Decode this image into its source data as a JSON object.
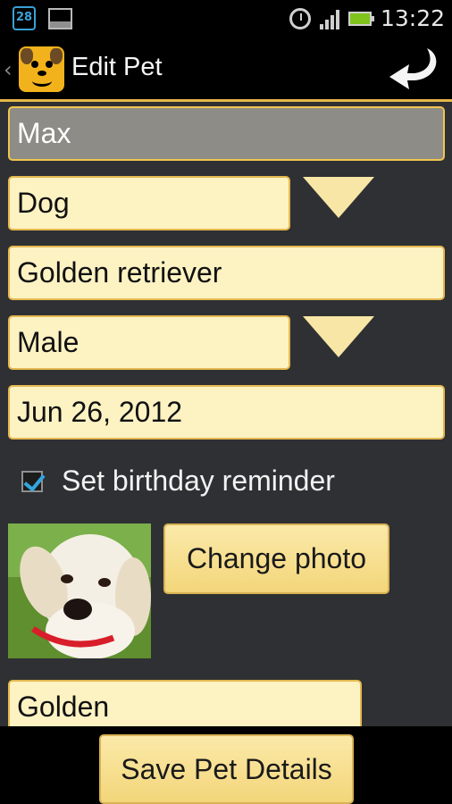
{
  "status_bar": {
    "calendar_day": "28",
    "time": "13:22"
  },
  "action_bar": {
    "title": "Edit Pet"
  },
  "form": {
    "name": "Max",
    "species": "Dog",
    "breed": "Golden retriever",
    "sex": "Male",
    "birthday": "Jun 26, 2012",
    "birthday_reminder": {
      "label": "Set birthday reminder",
      "checked": true
    },
    "change_photo_label": "Change photo",
    "color": "Golden"
  },
  "footer": {
    "save_label": "Save Pet Details"
  },
  "colors": {
    "accent": "#e5b84f",
    "field_bg": "#fdf2c2",
    "background": "#2f3033",
    "checkbox_tick": "#33a6e0"
  }
}
